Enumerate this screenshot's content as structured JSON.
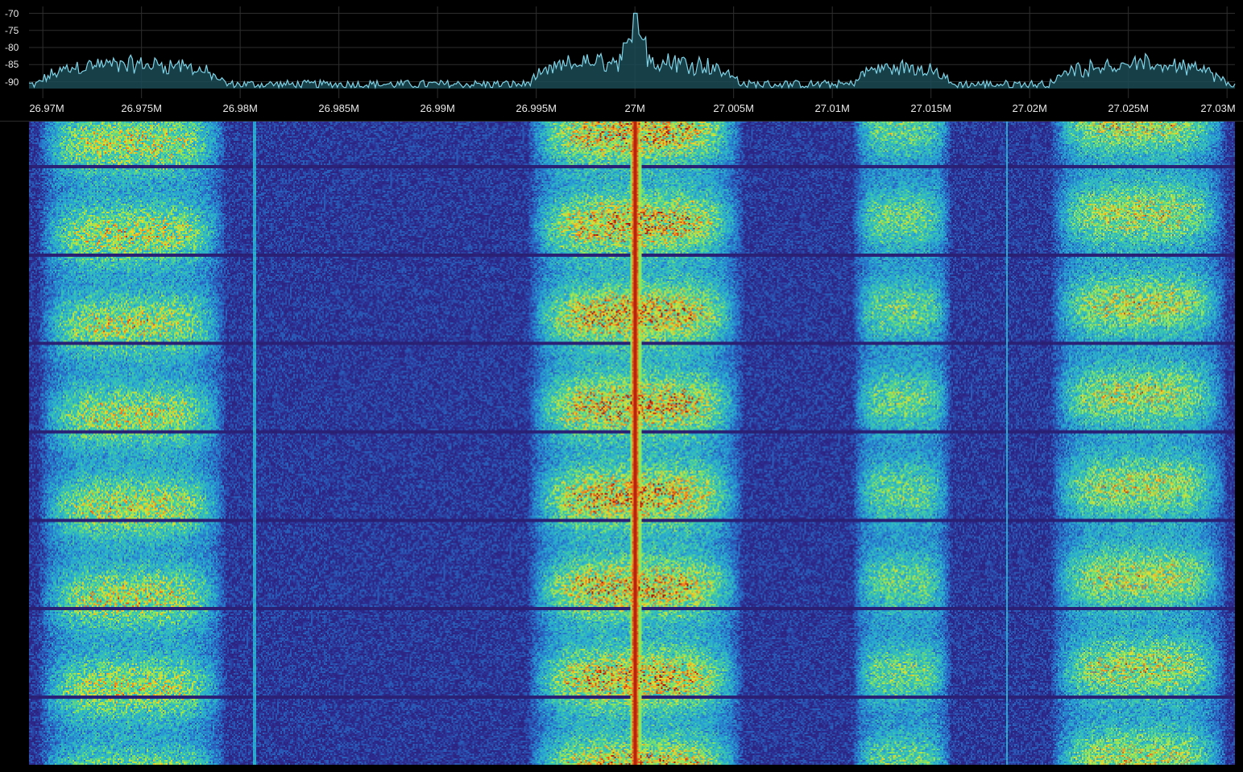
{
  "spectrum": {
    "db_ticks": [
      "-70",
      "-75",
      "-80",
      "-85",
      "-90"
    ],
    "db_values": [
      -70,
      -75,
      -80,
      -85,
      -90
    ],
    "freq_ticks": [
      "26.97M",
      "26.975M",
      "26.98M",
      "26.985M",
      "26.99M",
      "26.995M",
      "27M",
      "27.005M",
      "27.01M",
      "27.015M",
      "27.02M",
      "27.025M",
      "27.03M"
    ],
    "freq_values_mhz": [
      26.97,
      26.975,
      26.98,
      26.985,
      26.99,
      26.995,
      27.0,
      27.005,
      27.01,
      27.015,
      27.02,
      27.025,
      27.03
    ],
    "span_mhz": [
      26.9693,
      27.0304
    ],
    "db_range": [
      -92,
      -68
    ],
    "trace_color": "#7fd3e6",
    "trace_fill": "#1b4a55",
    "grid_color": "#2e2e2e",
    "carrier_peak_db": -70,
    "carrier_freq_mhz": 27.0
  },
  "waterfall": {
    "colormap": "turbo",
    "carrier_freq_mhz": 27.0,
    "background_color": "#2b1b66"
  }
}
